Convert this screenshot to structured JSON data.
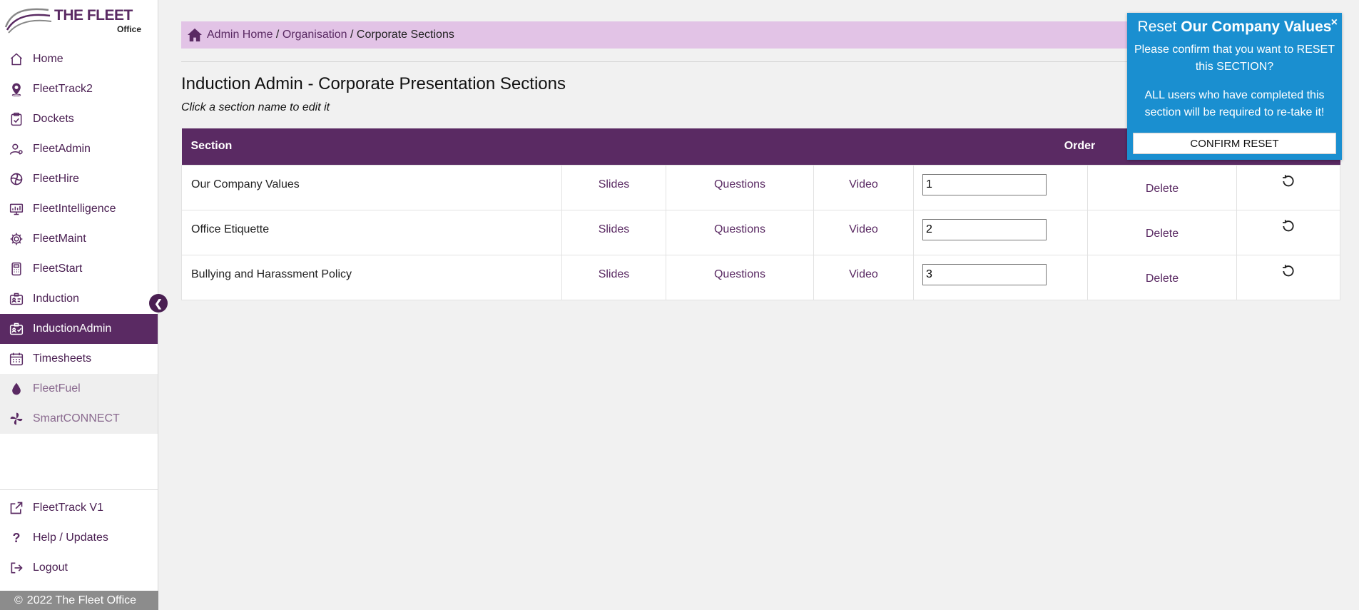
{
  "brand": {
    "name": "THE FLEET",
    "sub": "Office"
  },
  "sidebar": {
    "items": [
      {
        "label": "Home",
        "icon": "home-icon"
      },
      {
        "label": "FleetTrack2",
        "icon": "location-pin-icon"
      },
      {
        "label": "Dockets",
        "icon": "clipboard-check-icon"
      },
      {
        "label": "FleetAdmin",
        "icon": "user-cog-icon"
      },
      {
        "label": "FleetHire",
        "icon": "spiral-icon"
      },
      {
        "label": "FleetIntelligence",
        "icon": "monitor-chart-icon"
      },
      {
        "label": "FleetMaint",
        "icon": "gear-icon"
      },
      {
        "label": "FleetStart",
        "icon": "calculator-icon"
      },
      {
        "label": "Induction",
        "icon": "id-card-icon"
      },
      {
        "label": "InductionAdmin",
        "icon": "id-card-check-icon",
        "active": true
      },
      {
        "label": "Timesheets",
        "icon": "calendar-icon"
      },
      {
        "label": "FleetFuel",
        "icon": "droplet-icon",
        "disabled": true
      },
      {
        "label": "SmartCONNECT",
        "icon": "pinwheel-icon",
        "disabled": true
      }
    ],
    "bottom_items": [
      {
        "label": "FleetTrack V1",
        "icon": "external-link-icon"
      },
      {
        "label": "Help / Updates",
        "icon": "question-icon"
      },
      {
        "label": "Logout",
        "icon": "logout-icon"
      }
    ],
    "footer": "2022 The Fleet Office"
  },
  "breadcrumb": {
    "home": "Admin Home",
    "sep": " / ",
    "org": "Organisation",
    "current": "Corporate Sections"
  },
  "page": {
    "title": "Induction Admin - Corporate Presentation Sections",
    "subtitle": "Click a section name to edit it"
  },
  "table": {
    "headers": {
      "section": "Section",
      "order": "Order"
    },
    "rows": [
      {
        "name": "Our Company Values",
        "slides": "Slides",
        "questions": "Questions",
        "video": "Video",
        "order": "1",
        "delete": "Delete"
      },
      {
        "name": "Office Etiquette",
        "slides": "Slides",
        "questions": "Questions",
        "video": "Video",
        "order": "2",
        "delete": "Delete"
      },
      {
        "name": "Bullying and Harassment Policy",
        "slides": "Slides",
        "questions": "Questions",
        "video": "Video",
        "order": "3",
        "delete": "Delete"
      }
    ]
  },
  "popover": {
    "title_prefix": "Reset ",
    "title_bold": "Our Company Values",
    "close": "×",
    "body1": "Please confirm that you want to RESET this SECTION?",
    "body2": "ALL users who have completed this section will be required to re-take it!",
    "button": "CONFIRM RESET"
  },
  "colors": {
    "primary": "#5a2a63",
    "breadcrumb_bg": "#e2c3e6",
    "popover_bg": "#1a8fd0",
    "background": "#f1f1f1"
  }
}
